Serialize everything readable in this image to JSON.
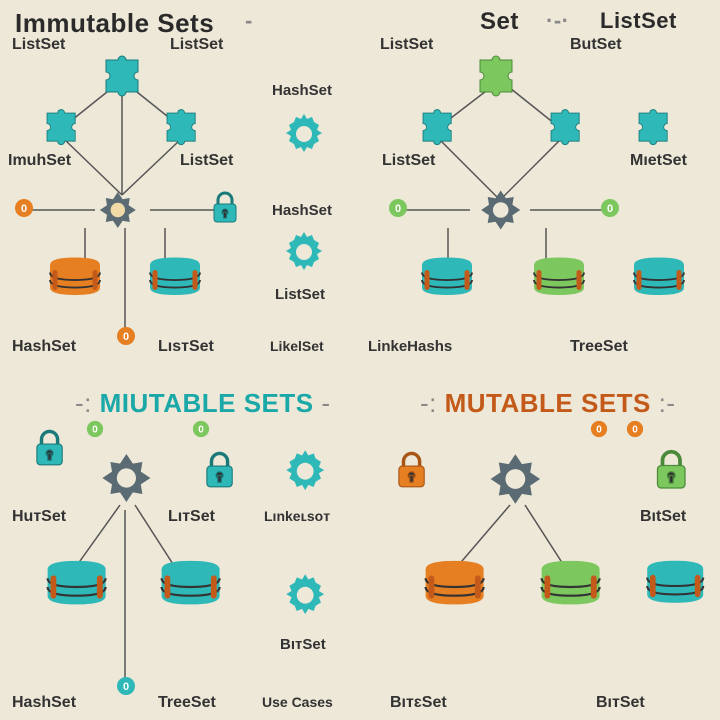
{
  "titles": {
    "immutable": "Immutable Sets",
    "set": "Set",
    "listset_top": "ListSet",
    "miutable": "MIUTABLE SETS",
    "mutable": "MUTABLE SETS"
  },
  "top_left": {
    "l1": "ListSet",
    "l2": "ListSet",
    "l3": "HashSet",
    "l4": "ImuhSet",
    "l5": "ListSet",
    "l6": "HashSet",
    "l7": "HashSet",
    "l8": "LısтSet",
    "l9": "ListSet",
    "l10": "LikelSet"
  },
  "top_right": {
    "l1": "ListSet",
    "l2": "ButSet",
    "l3": "ListSet",
    "l4": "MıetSet",
    "l5": "LinkeHashs",
    "l6": "TreeSet"
  },
  "bottom_left": {
    "l1": "HuтSet",
    "l2": "LıтSet",
    "l3": "Lınkeʟsoт",
    "l4": "HashSet",
    "l5": "TreeSet",
    "l6": "BıтSet",
    "l7": "Use Cases"
  },
  "bottom_right": {
    "l1": "BıtSet",
    "l2": "BıтɛSet",
    "l3": "BıтSet"
  },
  "colors": {
    "teal": "#2eb8b8",
    "teal_dark": "#1a9999",
    "orange": "#e67e22",
    "green": "#7cc85e",
    "slate": "#5a6b73",
    "slate_dark": "#3f4b52"
  }
}
